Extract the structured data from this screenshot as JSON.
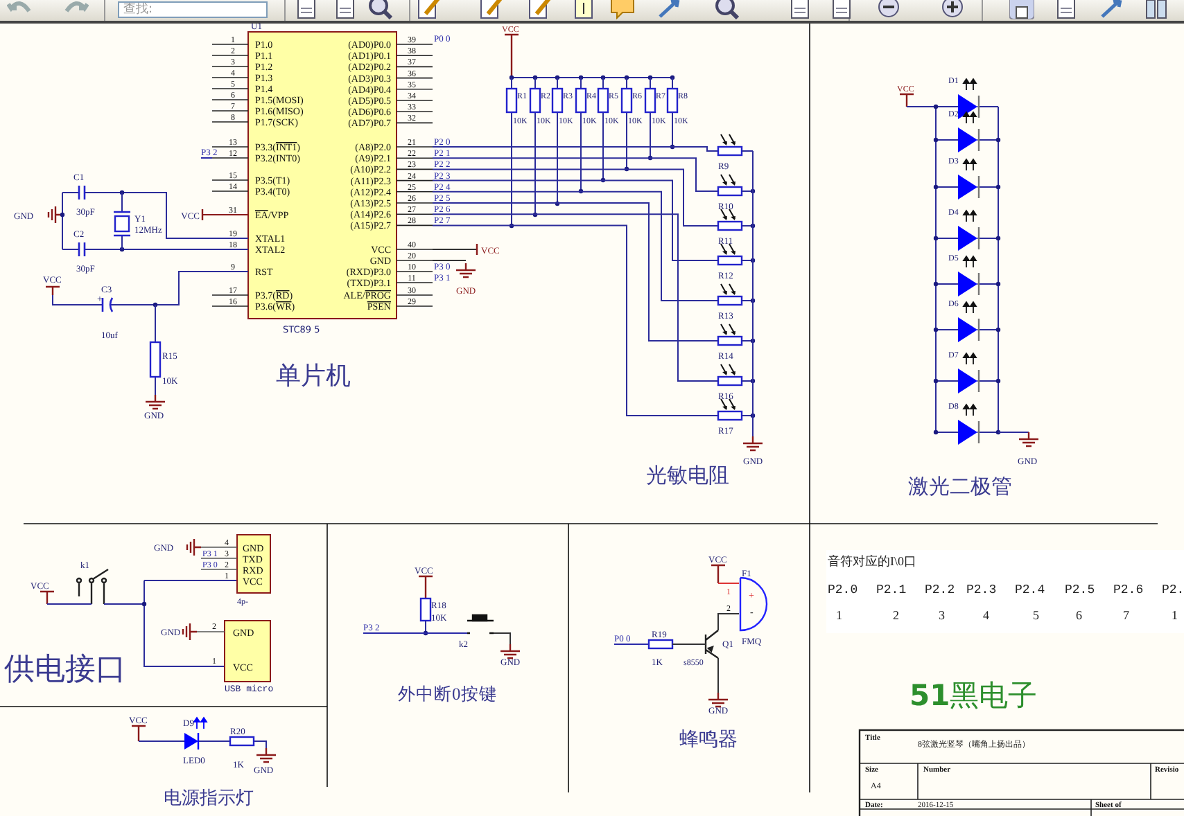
{
  "toolbar": {
    "search": {
      "placeholder": "查找:"
    }
  },
  "mcu": {
    "ref": "U1",
    "part": "STC89 5",
    "caption": "单片机",
    "net_p32": "P3 2",
    "net_p00": "P0 0",
    "net_vcc": "VCC",
    "net_p30": "P3 0",
    "net_p31": "P3 1",
    "net_gnd": "GND",
    "left_pins": [
      {
        "num": "1",
        "name": "P1.0"
      },
      {
        "num": "2",
        "name": "P1.1"
      },
      {
        "num": "3",
        "name": "P1.2"
      },
      {
        "num": "4",
        "name": "P1.3"
      },
      {
        "num": "5",
        "name": "P1.4"
      },
      {
        "num": "6",
        "name": "P1.5(MOSI)"
      },
      {
        "num": "7",
        "name": "P1.6(MISO)"
      },
      {
        "num": "8",
        "name": "P1.7(SCK)"
      },
      {
        "num": "13",
        "name": "P3.3(",
        "bar": "INT1",
        "tail": ")"
      },
      {
        "num": "12",
        "name": "P3.2(INT0)"
      },
      {
        "num": "15",
        "name": "P3.5(T1)"
      },
      {
        "num": "14",
        "name": "P3.4(T0)"
      },
      {
        "num": "31",
        "bar": "EA",
        "tail": "/VPP"
      },
      {
        "num": "19",
        "name": "XTAL1"
      },
      {
        "num": "18",
        "name": "XTAL2"
      },
      {
        "num": "9",
        "name": "RST"
      },
      {
        "num": "17",
        "name": "P3.7(",
        "bar": "RD",
        "tail": ")"
      },
      {
        "num": "16",
        "name": "P3.6(",
        "bar": "WR",
        "tail": ")"
      }
    ],
    "right_pins": [
      {
        "num": "39",
        "name": "(AD0)P0.0"
      },
      {
        "num": "38",
        "name": "(AD1)P0.1"
      },
      {
        "num": "37",
        "name": "(AD2)P0.2"
      },
      {
        "num": "36",
        "name": "(AD3)P0.3"
      },
      {
        "num": "35",
        "name": "(AD4)P0.4"
      },
      {
        "num": "34",
        "name": "(AD5)P0.5"
      },
      {
        "num": "33",
        "name": "(AD6)P0.6"
      },
      {
        "num": "32",
        "name": "(AD7)P0.7"
      },
      {
        "num": "21",
        "name": "(A8)P2.0"
      },
      {
        "num": "22",
        "name": "(A9)P2.1"
      },
      {
        "num": "23",
        "name": "(A10)P2.2"
      },
      {
        "num": "24",
        "name": "(A11)P2.3"
      },
      {
        "num": "25",
        "name": "(A12)P2.4"
      },
      {
        "num": "26",
        "name": "(A13)P2.5"
      },
      {
        "num": "27",
        "name": "(A14)P2.6"
      },
      {
        "num": "28",
        "name": "(A15)P2.7"
      },
      {
        "num": "40",
        "name": "VCC"
      },
      {
        "num": "20",
        "name": "GND"
      },
      {
        "num": "10",
        "name": "(RXD)P3.0"
      },
      {
        "num": "11",
        "name": "(TXD)P3.1"
      },
      {
        "num": "30",
        "name": "ALE/",
        "bar": "PROG"
      },
      {
        "num": "29",
        "bar": "PSEN"
      }
    ]
  },
  "crystal": {
    "gnd": "GND",
    "vcc": "VCC",
    "c1": {
      "ref": "C1",
      "value": "30pF"
    },
    "c2": {
      "ref": "C2",
      "value": "30pF"
    },
    "y1": {
      "ref": "Y1",
      "value": "12MHz"
    }
  },
  "reset": {
    "vcc": "VCC",
    "c3": {
      "ref": "C3",
      "value": "10uf",
      "polarity": "+"
    },
    "r15": {
      "ref": "R15",
      "value": "10K"
    },
    "gnd": "GND"
  },
  "pullups": {
    "vcc": "VCC",
    "resistors": [
      {
        "ref": "R1",
        "value": "10K"
      },
      {
        "ref": "R2",
        "value": "10K"
      },
      {
        "ref": "R3",
        "value": "10K"
      },
      {
        "ref": "R4",
        "value": "10K"
      },
      {
        "ref": "R5",
        "value": "10K"
      },
      {
        "ref": "R6",
        "value": "10K"
      },
      {
        "ref": "R7",
        "value": "10K"
      },
      {
        "ref": "R8",
        "value": "10K"
      }
    ]
  },
  "p2_nets": [
    "P2 0",
    "P2 1",
    "P2 2",
    "P2 3",
    "P2 4",
    "P2 5",
    "P2 6",
    "P2 7"
  ],
  "photoresistors": {
    "items": [
      {
        "ref": "R9"
      },
      {
        "ref": "R10"
      },
      {
        "ref": "R11"
      },
      {
        "ref": "R12"
      },
      {
        "ref": "R13"
      },
      {
        "ref": "R14"
      },
      {
        "ref": "R16"
      },
      {
        "ref": "R17"
      }
    ],
    "gnd": "GND",
    "caption": "光敏电阻"
  },
  "lasers": {
    "vcc": "VCC",
    "diodes": [
      {
        "ref": "D1"
      },
      {
        "ref": "D2"
      },
      {
        "ref": "D3"
      },
      {
        "ref": "D4"
      },
      {
        "ref": "D5"
      },
      {
        "ref": "D6"
      },
      {
        "ref": "D7"
      },
      {
        "ref": "D8"
      }
    ],
    "gnd": "GND",
    "caption": "激光二极管"
  },
  "power_input": {
    "switch": "k1",
    "vcc": "VCC",
    "header": {
      "label": "4p-",
      "pins": [
        {
          "num": "4",
          "name": "GND",
          "net": "GND"
        },
        {
          "num": "3",
          "name": "TXD",
          "net": "P3 1"
        },
        {
          "num": "2",
          "name": "RXD",
          "net": "P3 0"
        },
        {
          "num": "1",
          "name": "VCC"
        }
      ]
    },
    "usb": {
      "label": "USB micro",
      "pins": [
        {
          "num": "2",
          "name": "GND",
          "net": "GND"
        },
        {
          "num": "1",
          "name": "VCC"
        }
      ]
    },
    "caption": "供电接口"
  },
  "power_led": {
    "vcc": "VCC",
    "led": {
      "ref": "D9",
      "value": "LED0"
    },
    "resistor": {
      "ref": "R20",
      "value": "1K"
    },
    "gnd": "GND",
    "caption": "电源指示灯"
  },
  "interrupt_key": {
    "vcc": "VCC",
    "resistor": {
      "ref": "R18",
      "value": "10K"
    },
    "net": "P3 2",
    "key": "k2",
    "gnd": "GND",
    "caption": "外中断0按键"
  },
  "buzzer": {
    "vcc": "VCC",
    "buzzer": {
      "ref": "F1",
      "value": "FMQ",
      "pin1": "1",
      "pin2": "2",
      "plus": "+",
      "minus": "-"
    },
    "transistor": {
      "ref": "Q1",
      "value": "s8550"
    },
    "resistor": {
      "ref": "R19",
      "value": "1K"
    },
    "net": "P0 0",
    "gnd": "GND",
    "caption": "蜂鸣器"
  },
  "note_table": {
    "title": "音符对应的I\\0口",
    "pins": [
      "P2.0",
      "P2.1",
      "P2.2",
      "P2.3",
      "P2.4",
      "P2.5",
      "P2.6",
      "P2."
    ],
    "notes": [
      "1",
      "2",
      "3",
      "4",
      "5",
      "6",
      "7",
      "1"
    ]
  },
  "brand": "**51**黑电子",
  "title_block": {
    "title_label": "Title",
    "title": "8弦激光竖琴（嘴角上扬出品）",
    "size_label": "Size",
    "size": "A4",
    "number_label": "Number",
    "revision_label": "Revisio",
    "date_label": "Date:",
    "date": "2016-12-15",
    "sheet_label": "Sheet  of"
  }
}
